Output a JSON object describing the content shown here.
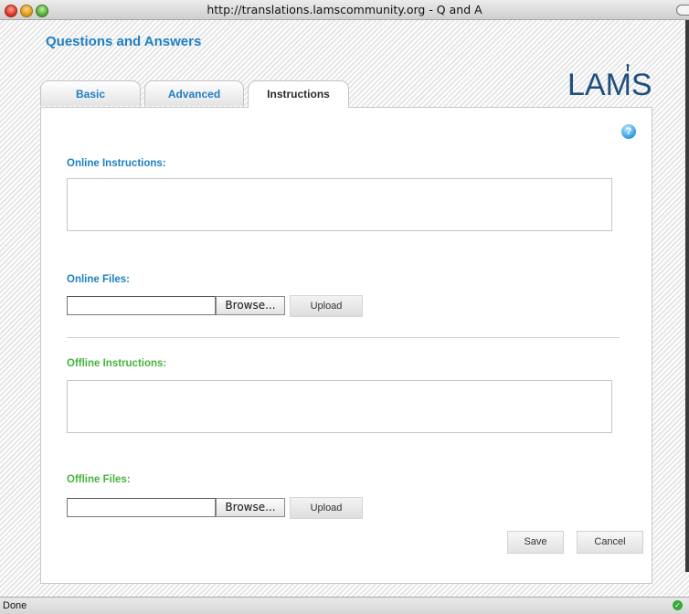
{
  "window": {
    "title": "http://translations.lamscommunity.org - Q and A"
  },
  "page": {
    "title": "Questions and Answers",
    "logo_text": "LAMS"
  },
  "tabs": [
    {
      "label": "Basic"
    },
    {
      "label": "Advanced"
    },
    {
      "label": "Instructions",
      "active": true
    }
  ],
  "help": {
    "icon": "help-icon",
    "glyph": "?"
  },
  "online": {
    "instructions_label": "Online Instructions:",
    "instructions_value": "",
    "files_label": "Online Files:",
    "file_value": "",
    "browse_label": "Browse...",
    "upload_label": "Upload"
  },
  "offline": {
    "instructions_label": "Offline Instructions:",
    "instructions_value": "",
    "files_label": "Offline Files:",
    "file_value": "",
    "browse_label": "Browse...",
    "upload_label": "Upload"
  },
  "actions": {
    "save_label": "Save",
    "cancel_label": "Cancel"
  },
  "status": {
    "text": "Done",
    "icon": "checkmark-icon"
  },
  "colors": {
    "accent_blue": "#1e7fc2",
    "accent_green": "#46b33c"
  }
}
